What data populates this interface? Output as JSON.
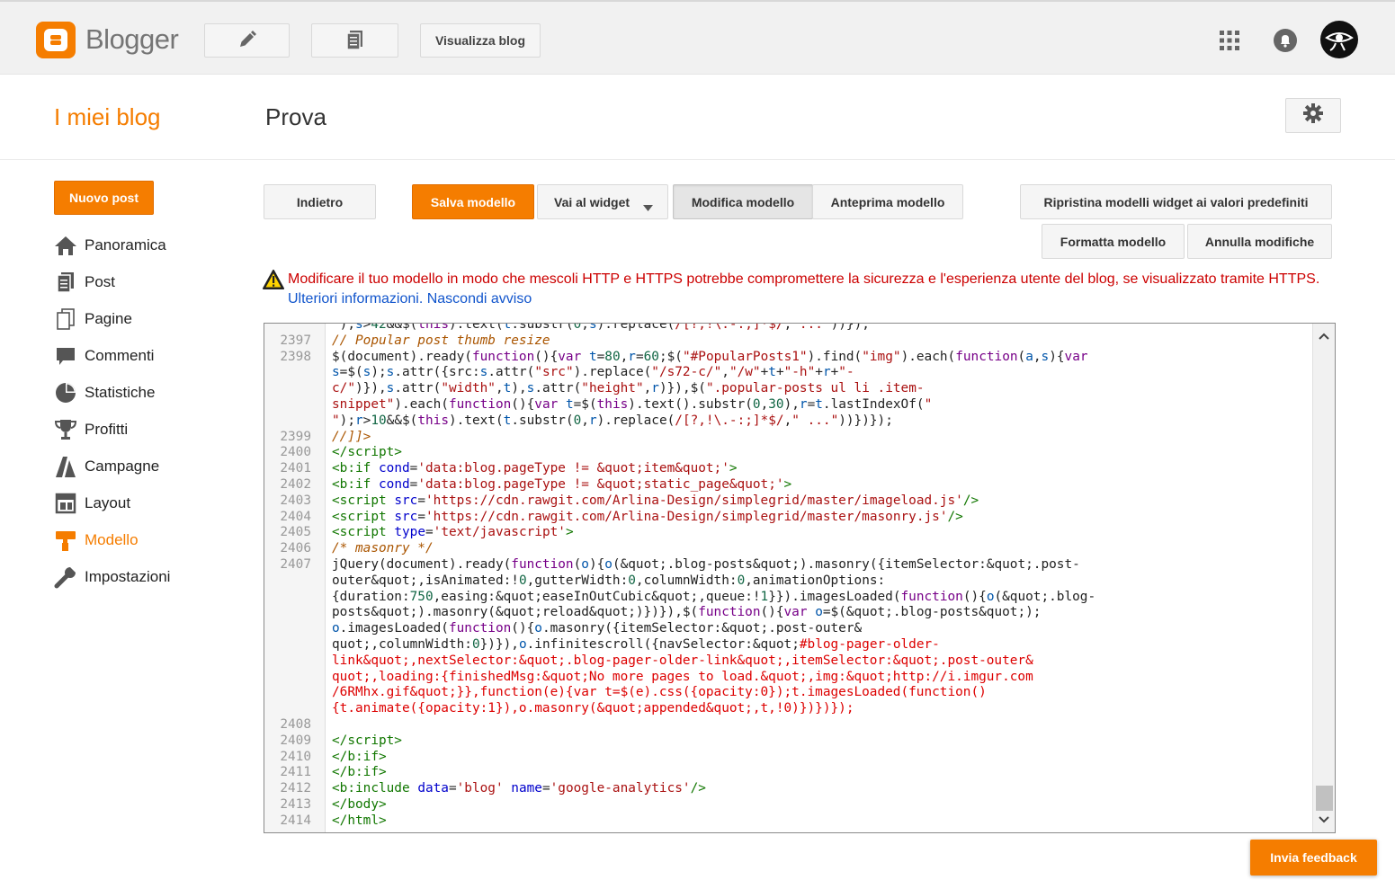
{
  "topbar": {
    "brand": "Blogger",
    "view_blog_label": "Visualizza blog",
    "icons": [
      "pencil-icon",
      "pages-icon",
      "apps-grid-icon",
      "notifications-icon",
      "account-avatar"
    ]
  },
  "header": {
    "my_blogs": "I miei blog",
    "blog_title": "Prova"
  },
  "sidebar": {
    "new_post_label": "Nuovo post",
    "items": [
      {
        "label": "Panoramica",
        "icon": "home-icon"
      },
      {
        "label": "Post",
        "icon": "posts-icon"
      },
      {
        "label": "Pagine",
        "icon": "pages-icon"
      },
      {
        "label": "Commenti",
        "icon": "comments-icon"
      },
      {
        "label": "Statistiche",
        "icon": "stats-icon"
      },
      {
        "label": "Profitti",
        "icon": "trophy-icon"
      },
      {
        "label": "Campagne",
        "icon": "campaigns-icon"
      },
      {
        "label": "Layout",
        "icon": "layout-icon"
      },
      {
        "label": "Modello",
        "icon": "template-icon"
      },
      {
        "label": "Impostazioni",
        "icon": "wrench-icon"
      }
    ],
    "active": "Modello"
  },
  "toolbar": {
    "back": "Indietro",
    "save": "Salva modello",
    "jump_widget": "Vai al widget",
    "edit": "Modifica modello",
    "preview": "Anteprima modello",
    "reset_widgets": "Ripristina modelli widget ai valori predefiniti",
    "format": "Formatta modello",
    "revert": "Annulla modifiche"
  },
  "warning": {
    "text": "Modificare il tuo modello in modo che mescoli HTTP e HTTPS potrebbe compromettere la sicurezza e l'esperienza utente del blog, se visualizzato tramite HTTPS. ",
    "learn_more": "Ulteriori informazioni.",
    "hide": "Nascondi avviso"
  },
  "editor": {
    "line_numbers": [
      "",
      "2397",
      "2398",
      "",
      "",
      "",
      "",
      "2399",
      "2400",
      "2401",
      "2402",
      "2403",
      "2404",
      "2405",
      "2406",
      "2407",
      "",
      "",
      "",
      "",
      "",
      "",
      "",
      "",
      "",
      "2408",
      "2409",
      "2410",
      "2411",
      "2412",
      "2413",
      "2414"
    ]
  },
  "feedback_label": "Invia feedback",
  "colors": {
    "accent": "#f57d00",
    "warning_text": "#cc0000",
    "link": "#1155cc"
  }
}
